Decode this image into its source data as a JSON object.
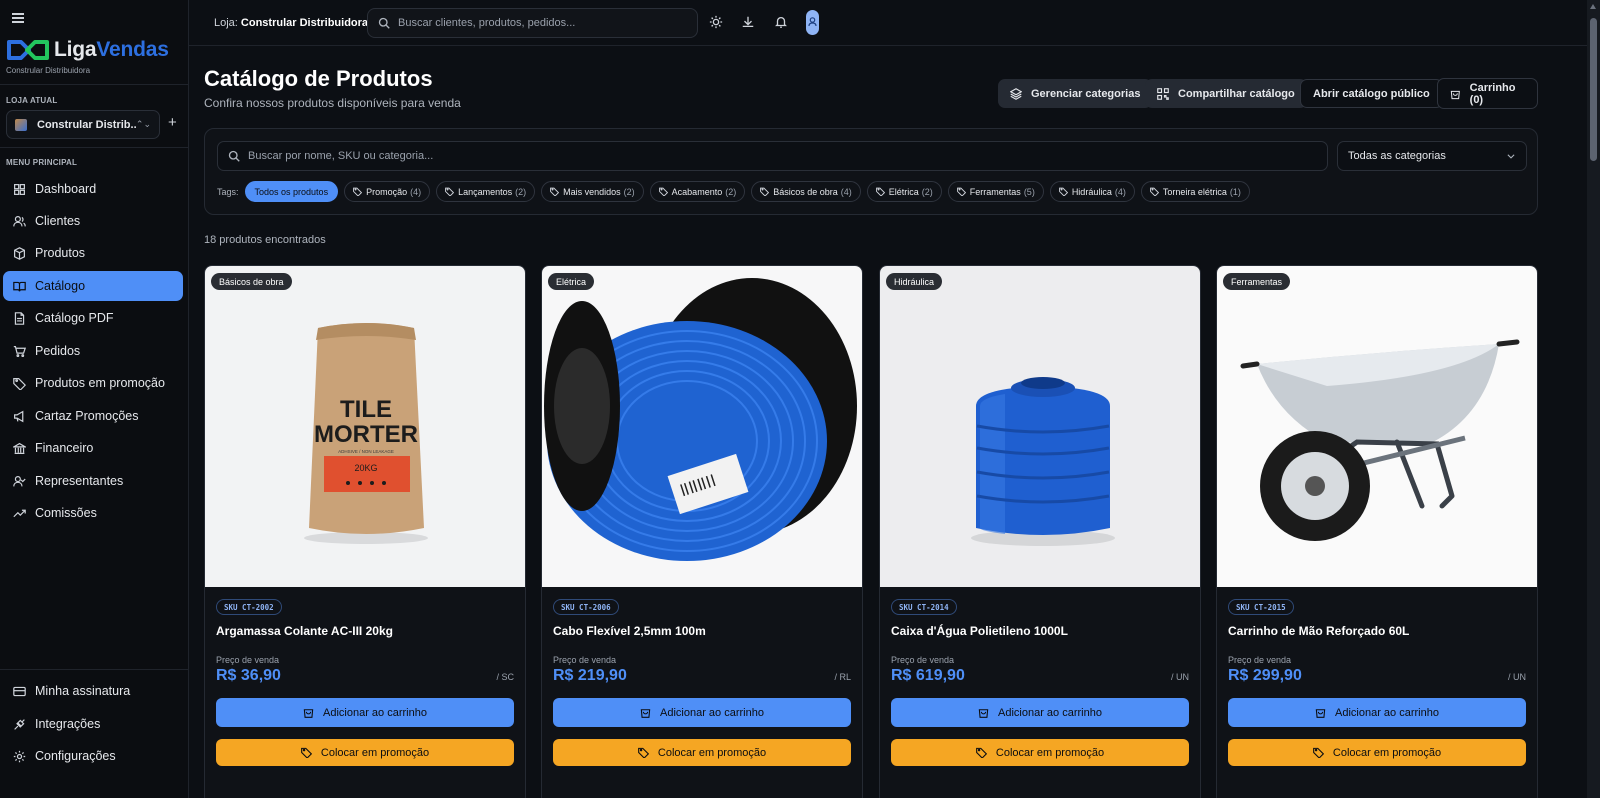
{
  "brand": {
    "liga": "Liga",
    "vendas": "Vendas",
    "subtitle": "Constrular Distribuidora"
  },
  "sidebar": {
    "store_section_label": "LOJA ATUAL",
    "store_name": "Constrular Distrib...",
    "menu_section_label": "MENU PRINCIPAL",
    "items": [
      {
        "label": "Dashboard",
        "icon": "dashboard-icon"
      },
      {
        "label": "Clientes",
        "icon": "users-icon"
      },
      {
        "label": "Produtos",
        "icon": "box-icon"
      },
      {
        "label": "Catálogo",
        "icon": "book-open-icon",
        "active": true
      },
      {
        "label": "Catálogo PDF",
        "icon": "file-icon"
      },
      {
        "label": "Pedidos",
        "icon": "cart-icon"
      },
      {
        "label": "Produtos em promoção",
        "icon": "tag-icon"
      },
      {
        "label": "Cartaz Promoções",
        "icon": "megaphone-icon"
      },
      {
        "label": "Financeiro",
        "icon": "bank-icon"
      },
      {
        "label": "Representantes",
        "icon": "user-check-icon"
      },
      {
        "label": "Comissões",
        "icon": "trending-up-icon"
      }
    ],
    "bottom_items": [
      {
        "label": "Minha assinatura",
        "icon": "credit-card-icon"
      },
      {
        "label": "Integrações",
        "icon": "plug-icon"
      },
      {
        "label": "Configurações",
        "icon": "gear-icon"
      }
    ]
  },
  "topbar": {
    "store_prefix": "Loja:",
    "store_name": "Constrular Distribuidora",
    "search_placeholder": "Buscar clientes, produtos, pedidos..."
  },
  "header": {
    "title": "Catálogo de Produtos",
    "subtitle": "Confira nossos produtos disponíveis para venda",
    "buttons": {
      "manage": "Gerenciar categorias",
      "share": "Compartilhar catálogo",
      "public": "Abrir catálogo público",
      "cart": "Carrinho (0)"
    }
  },
  "filters": {
    "search_placeholder": "Buscar por nome, SKU ou categoria...",
    "category_selected": "Todas as categorias",
    "tags_label": "Tags:",
    "tags": [
      {
        "label": "Todos os produtos",
        "count": "",
        "active": true
      },
      {
        "label": "Promoção",
        "count": "(4)"
      },
      {
        "label": "Lançamentos",
        "count": "(2)"
      },
      {
        "label": "Mais vendidos",
        "count": "(2)"
      },
      {
        "label": "Acabamento",
        "count": "(2)"
      },
      {
        "label": "Básicos de obra",
        "count": "(4)"
      },
      {
        "label": "Elétrica",
        "count": "(2)"
      },
      {
        "label": "Ferramentas",
        "count": "(5)"
      },
      {
        "label": "Hidráulica",
        "count": "(4)"
      },
      {
        "label": "Torneira elétrica",
        "count": "(1)"
      }
    ]
  },
  "results_text": "18 produtos encontrados",
  "products": [
    {
      "category": "Básicos de obra",
      "sku": "SKU CT-2002",
      "name": "Argamassa Colante AC-III 20kg",
      "price_label": "Preço de venda",
      "price": "R$ 36,90",
      "unit": "/ SC",
      "cart_label": "Adicionar ao carrinho",
      "promo_label": "Colocar em promoção",
      "image_icon": "cement-bag",
      "bag_line1": "TILE",
      "bag_line2": "MORTER",
      "bag_line3": "ADHSIVE / NON LEAKAGE",
      "bag_weight": "20KG"
    },
    {
      "category": "Elétrica",
      "sku": "SKU CT-2006",
      "name": "Cabo Flexível 2,5mm 100m",
      "price_label": "Preço de venda",
      "price": "R$ 219,90",
      "unit": "/ RL",
      "cart_label": "Adicionar ao carrinho",
      "promo_label": "Colocar em promoção",
      "image_icon": "cable-reel"
    },
    {
      "category": "Hidráulica",
      "sku": "SKU CT-2014",
      "name": "Caixa d'Água Polietileno 1000L",
      "price_label": "Preço de venda",
      "price": "R$ 619,90",
      "unit": "/ UN",
      "cart_label": "Adicionar ao carrinho",
      "promo_label": "Colocar em promoção",
      "image_icon": "water-tank"
    },
    {
      "category": "Ferramentas",
      "sku": "SKU CT-2015",
      "name": "Carrinho de Mão Reforçado 60L",
      "price_label": "Preço de venda",
      "price": "R$ 299,90",
      "unit": "/ UN",
      "cart_label": "Adicionar ao carrinho",
      "promo_label": "Colocar em promoção",
      "image_icon": "wheelbarrow"
    }
  ],
  "colors": {
    "accent": "#4f8ff7",
    "promo": "#f5a623",
    "brand_blue": "#2d6fe0",
    "brand_green": "#22c55e"
  }
}
